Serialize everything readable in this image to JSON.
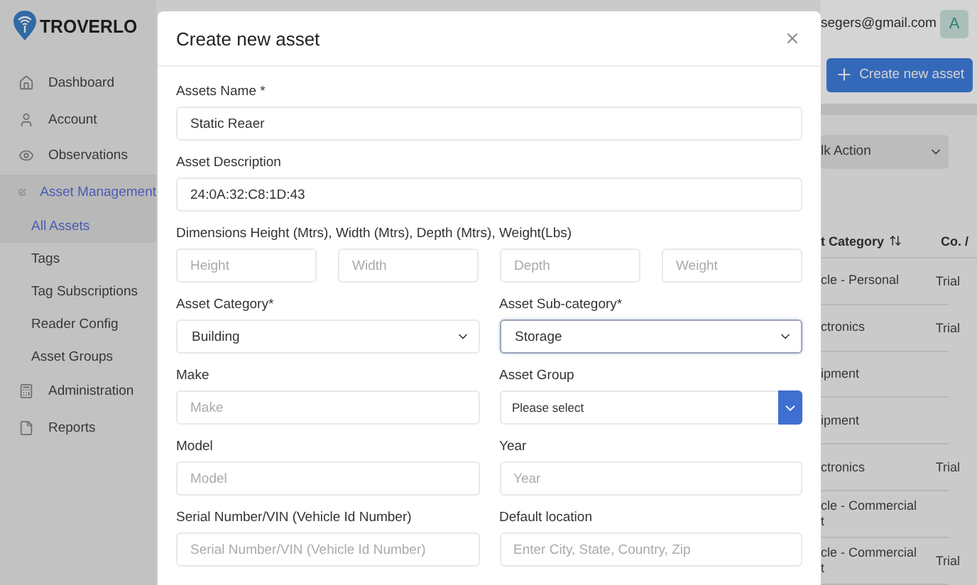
{
  "brand": "TROVERLO",
  "sidebar": {
    "items": [
      {
        "label": "Dashboard",
        "selected": false
      },
      {
        "label": "Account",
        "selected": false
      },
      {
        "label": "Observations",
        "selected": false
      },
      {
        "label": "Asset Management",
        "selected": true,
        "children": [
          {
            "label": "All Assets",
            "selected": true
          },
          {
            "label": "Tags",
            "selected": false
          },
          {
            "label": "Tag Subscriptions",
            "selected": false
          },
          {
            "label": "Reader Config",
            "selected": false
          },
          {
            "label": "Asset Groups",
            "selected": false
          }
        ]
      },
      {
        "label": "Administration",
        "selected": false
      },
      {
        "label": "Reports",
        "selected": false
      }
    ]
  },
  "header": {
    "email": "segers@gmail.com",
    "avatar": "A"
  },
  "toolbar": {
    "create_button": "Create new asset",
    "bulk_action": "lk Action"
  },
  "table": {
    "columns": [
      "t Category",
      "Co. /"
    ],
    "rows": [
      {
        "category": [
          "cle - Personal"
        ],
        "co": "Trial"
      },
      {
        "category": [
          "ctronics"
        ],
        "co": "Trial"
      },
      {
        "category": [
          "ipment"
        ]
      },
      {
        "category": [
          "ipment"
        ]
      },
      {
        "category": [
          "ctronics"
        ],
        "co": "Trial"
      },
      {
        "category": [
          "cle - Commercial",
          "t"
        ]
      },
      {
        "category": [
          "cle - Commercial",
          "t"
        ],
        "co": "Trial"
      }
    ]
  },
  "modal": {
    "title": "Create new asset",
    "rows": [
      {
        "fields": [
          {
            "kind": "text",
            "label": "Assets Name *",
            "value": "Static Reaer"
          }
        ]
      },
      {
        "fields": [
          {
            "kind": "text",
            "label": "Asset Description",
            "value": "24:0A:32:C8:1D:43"
          }
        ]
      },
      {
        "fields": [
          {
            "kind": "multi",
            "label": "Dimensions Height (Mtrs), Width (Mtrs), Depth (Mtrs), Weight(Lbs)",
            "placeholders": [
              "Height",
              "Width",
              "Depth",
              "Weight"
            ]
          }
        ]
      },
      {
        "fields": [
          {
            "kind": "select",
            "label": "Asset Category*",
            "value": "Building",
            "focused": false
          },
          {
            "kind": "select",
            "label": "Asset Sub-category*",
            "value": "Storage",
            "focused": true
          }
        ]
      },
      {
        "fields": [
          {
            "kind": "text",
            "label": "Make",
            "placeholder": "Make"
          },
          {
            "kind": "combo",
            "label": "Asset Group",
            "value": "Please select"
          }
        ]
      },
      {
        "fields": [
          {
            "kind": "text",
            "label": "Model",
            "placeholder": "Model"
          },
          {
            "kind": "text",
            "label": "Year",
            "placeholder": "Year"
          }
        ]
      },
      {
        "fields": [
          {
            "kind": "text",
            "label": "Serial Number/VIN (Vehicle Id Number)",
            "placeholder": "Serial Number/VIN (Vehicle Id Number)"
          },
          {
            "kind": "text",
            "label": "Default location",
            "placeholder": "Enter City, State, Country, Zip"
          }
        ]
      }
    ]
  }
}
